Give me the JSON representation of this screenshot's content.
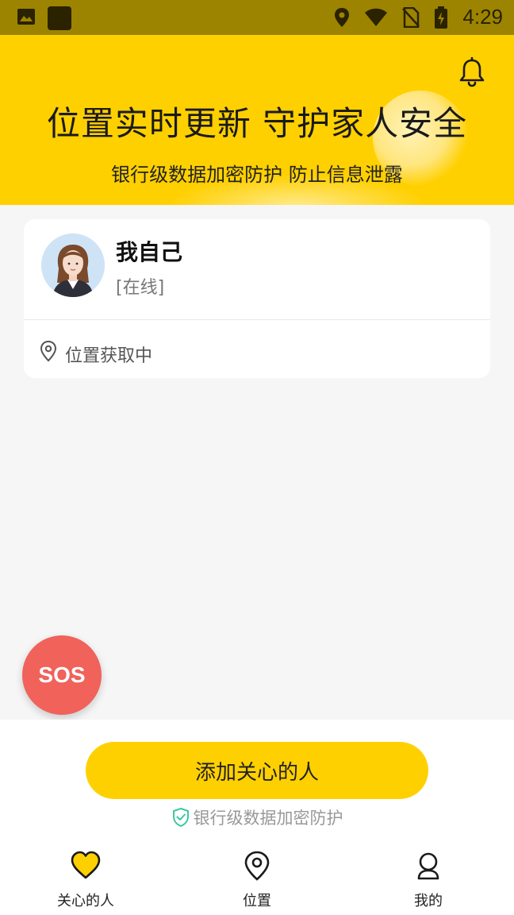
{
  "status_bar": {
    "time": "4:29"
  },
  "banner": {
    "headline": "位置实时更新 守护家人安全",
    "subline": "银行级数据加密防护 防止信息泄露"
  },
  "card": {
    "name": "我自己",
    "status": "[在线]",
    "location_text": "位置获取中"
  },
  "sos": {
    "label": "SOS"
  },
  "bottom": {
    "add_button": "添加关心的人",
    "secure_note": "银行级数据加密防护"
  },
  "tabs": [
    {
      "label": "关心的人",
      "icon": "heart-icon"
    },
    {
      "label": "位置",
      "icon": "location-pin-icon"
    },
    {
      "label": "我的",
      "icon": "profile-icon"
    }
  ],
  "colors": {
    "accent": "#ffd000",
    "sos": "#f0625a",
    "status_bar": "#9c8400"
  }
}
